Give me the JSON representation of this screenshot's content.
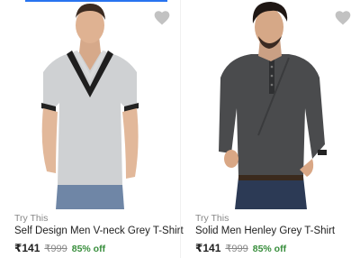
{
  "colors": {
    "accent": "#2874f0",
    "discount": "#388e3c",
    "muted": "#878787",
    "wishlist": "#c2c2c2"
  },
  "products": [
    {
      "tag": "Try This",
      "title": "Self Design Men V-neck Grey T-Shirt",
      "price": "₹141",
      "mrp": "₹999",
      "discount": "85% off",
      "icon": "heart-icon"
    },
    {
      "tag": "Try This",
      "title": "Solid Men Henley Grey T-Shirt",
      "price": "₹141",
      "mrp": "₹999",
      "discount": "85% off",
      "icon": "heart-icon"
    }
  ]
}
